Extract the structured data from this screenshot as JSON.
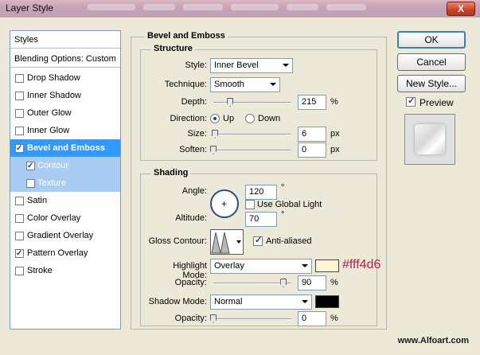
{
  "window": {
    "title": "Layer Style",
    "close_glyph": "X"
  },
  "styles_list": {
    "header": "Styles",
    "blending": "Blending Options: Custom",
    "items": [
      {
        "label": "Drop Shadow",
        "checked": false
      },
      {
        "label": "Inner Shadow",
        "checked": false
      },
      {
        "label": "Outer Glow",
        "checked": false
      },
      {
        "label": "Inner Glow",
        "checked": false
      },
      {
        "label": "Bevel and Emboss",
        "checked": true,
        "selected": true
      },
      {
        "label": "Contour",
        "checked": true,
        "sub": true
      },
      {
        "label": "Texture",
        "checked": false,
        "sub": true
      },
      {
        "label": "Satin",
        "checked": false
      },
      {
        "label": "Color Overlay",
        "checked": false
      },
      {
        "label": "Gradient Overlay",
        "checked": false
      },
      {
        "label": "Pattern Overlay",
        "checked": true
      },
      {
        "label": "Stroke",
        "checked": false
      }
    ]
  },
  "bevel": {
    "title": "Bevel and Emboss",
    "structure_title": "Structure",
    "style_label": "Style:",
    "style_value": "Inner Bevel",
    "technique_label": "Technique:",
    "technique_value": "Smooth",
    "depth_label": "Depth:",
    "depth_value": "215",
    "depth_unit": "%",
    "depth_level": 0.215,
    "direction_label": "Direction:",
    "dir_up": "Up",
    "dir_down": "Down",
    "direction_selected": "Up",
    "size_label": "Size:",
    "size_value": "6",
    "size_unit": "px",
    "size_level": 0.02,
    "soften_label": "Soften:",
    "soften_value": "0",
    "soften_unit": "px",
    "soften_level": 0
  },
  "shading": {
    "title": "Shading",
    "angle_label": "Angle:",
    "angle_value": "120",
    "angle_unit": "°",
    "global_light": "Use Global Light",
    "global_light_checked": false,
    "altitude_label": "Altitude:",
    "altitude_value": "70",
    "altitude_unit": "°",
    "gloss_label": "Gloss Contour:",
    "anti_aliased": "Anti-aliased",
    "anti_aliased_checked": true,
    "highlight_label": "Highlight Mode:",
    "highlight_value": "Overlay",
    "highlight_color": "#fff4d6",
    "hl_opacity_label": "Opacity:",
    "hl_opacity_value": "90",
    "hl_opacity_unit": "%",
    "hl_opacity_level": 0.9,
    "shadow_label": "Shadow Mode:",
    "shadow_value": "Normal",
    "shadow_color": "#000000",
    "sh_opacity_label": "Opacity:",
    "sh_opacity_value": "0",
    "sh_opacity_unit": "%",
    "sh_opacity_level": 0
  },
  "buttons": {
    "ok": "OK",
    "cancel": "Cancel",
    "new_style": "New Style...",
    "preview": "Preview",
    "preview_checked": true
  },
  "annotation": {
    "hex": "#fff4d6"
  },
  "watermark": "www.Alfoart.com"
}
